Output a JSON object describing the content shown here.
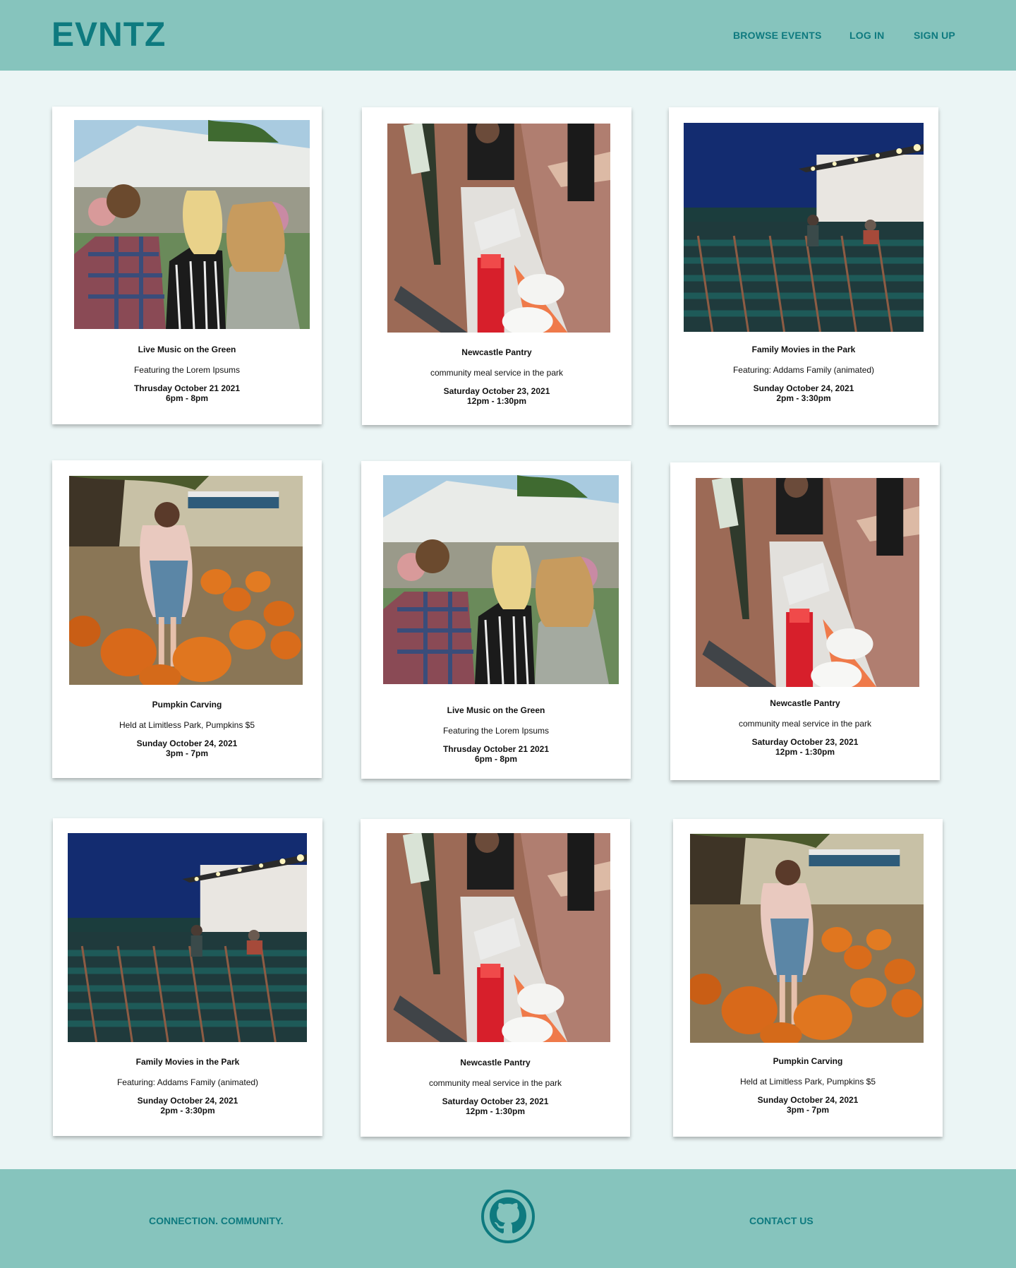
{
  "brand": {
    "name": "EVNTZ"
  },
  "nav": {
    "browse": "BROWSE EVENTS",
    "login": "LOG IN",
    "signup": "SIGN UP"
  },
  "events": [
    {
      "title": "Live Music on the Green",
      "description": "Featuring the Lorem Ipsums",
      "date": "Thrusday October 21 2021",
      "time": "6pm - 8pm",
      "image": "music-crowd-photo"
    },
    {
      "title": "Newcastle Pantry",
      "description": "community meal service in the park",
      "date": "Saturday October 23, 2021",
      "time": "12pm - 1:30pm",
      "image": "food-table-photo"
    },
    {
      "title": "Family Movies in the Park",
      "description": "Featuring: Addams Family (animated)",
      "date": "Sunday October 24, 2021",
      "time": "2pm - 3:30pm",
      "image": "outdoor-movie-photo"
    },
    {
      "title": "Pumpkin Carving",
      "description": "Held at Limitless Park, Pumpkins $5",
      "date": "Sunday October 24, 2021",
      "time": "3pm - 7pm",
      "image": "pumpkin-patch-photo"
    },
    {
      "title": "Live Music on the Green",
      "description": "Featuring the Lorem Ipsums",
      "date": "Thrusday October 21 2021",
      "time": "6pm - 8pm",
      "image": "music-crowd-photo"
    },
    {
      "title": "Newcastle Pantry",
      "description": "community meal service in the park",
      "date": "Saturday October 23, 2021",
      "time": "12pm - 1:30pm",
      "image": "food-table-photo"
    },
    {
      "title": "Family Movies in the Park",
      "description": "Featuring: Addams Family (animated)",
      "date": "Sunday October 24, 2021",
      "time": "2pm - 3:30pm",
      "image": "outdoor-movie-photo"
    },
    {
      "title": "Newcastle Pantry",
      "description": "community meal service in the park",
      "date": "Saturday October 23, 2021",
      "time": "12pm - 1:30pm",
      "image": "food-table-photo"
    },
    {
      "title": "Pumpkin Carving",
      "description": "Held at Limitless Park, Pumpkins $5",
      "date": "Sunday October 24, 2021",
      "time": "3pm - 7pm",
      "image": "pumpkin-patch-photo"
    }
  ],
  "footer": {
    "tagline": "CONNECTION. COMMUNITY.",
    "contact": "CONTACT US",
    "icon": "github-icon"
  },
  "colors": {
    "header_bg": "#86c4bd",
    "accent": "#0e7a7f",
    "page_bg": "#ebf5f5"
  }
}
